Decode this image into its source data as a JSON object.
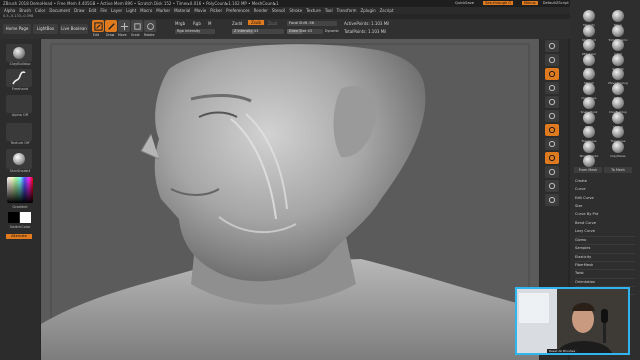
{
  "titlebar": {
    "text": "ZBrush 2018  DemoHead  • Free Mem 4.405GB • Active Mem 896 • Scratch Disk 152 • Timer▸0.016 • PolyCount▸1.102 MP • MeshCount▸1",
    "quicksave": "QuickSave",
    "seethrough": "See-through 0",
    "menus": "Menus",
    "script": "DefaultZScript"
  },
  "menus": [
    "Alpha",
    "Brush",
    "Color",
    "Document",
    "Draw",
    "Edit",
    "File",
    "Layer",
    "Light",
    "Macro",
    "Marker",
    "Material",
    "Movie",
    "Picker",
    "Preferences",
    "Render",
    "Stencil",
    "Stroke",
    "Texture",
    "Tool",
    "Transform",
    "Zplugin",
    "Zscript"
  ],
  "coords": "0.5,-0.133,-0.398",
  "shelf": {
    "home_page": "Home Page",
    "lightbox": "LightBox",
    "live_boolean": "Live Boolean",
    "edit": "Edit",
    "draw": "Draw",
    "move": "Move",
    "scale": "Scale",
    "rotate": "Rotate",
    "mrgb": "Mrgb",
    "rgb": "Rgb",
    "m": "M",
    "zadd": "Zadd",
    "zsub": "Zsub",
    "zcut": "Zcut",
    "rgb_intensity": "Rgb Intensity",
    "z_intensity": "Z Intensity 43",
    "focal_shift": "Focal Shift -56",
    "draw_size": "Draw Size 43",
    "dynamic": "Dynamic",
    "active_points": "ActivePoints: 1.103 Mil",
    "total_points": "TotalPoints: 1.103 Mil",
    "z_intensity_value": 43,
    "draw_size_value": 43
  },
  "leftpanel": {
    "brush": "ClayBuildup",
    "stroke": "Freehand",
    "alpha": "Alpha Off",
    "texture": "Texture Off",
    "material": "SkinShade4",
    "gradient": "Gradient",
    "switch_color": "SwitchColor",
    "alternate": "Alternate"
  },
  "rightcol": [
    "Frame",
    "Move",
    "Scale",
    "Rotate",
    "Floor",
    "Local",
    "LSym",
    "Xyz",
    "Persp",
    "PolyF",
    "Transp",
    "Solo"
  ],
  "brushes": [
    [
      "Magnify",
      "Move"
    ],
    [
      "Standard",
      "TrimDynamic"
    ],
    [
      "ZModeler",
      "Inflat"
    ],
    [
      "Pinch",
      "Smooth"
    ],
    [
      "hPolish",
      "MoveTopolog"
    ],
    [
      "ClayTubes",
      "Polish"
    ],
    [
      "SnakeHook",
      "ClayBuildup"
    ],
    [
      "Pinch",
      "hPolish"
    ],
    [
      "Transpose",
      "Transpose"
    ],
    [
      "Move Elastic",
      "ClayTubes"
    ],
    [
      "DamStandard",
      ""
    ]
  ],
  "brush_buttons": {
    "from_mesh": "From Mesh",
    "to_mesh": "To Mesh"
  },
  "tool_menu": [
    "Create",
    "Curve",
    "Edit Curve",
    "Size",
    "Curve By Pnt",
    "Bend Curve",
    "Lazy Curve",
    "Gizmo",
    "Samples",
    "Elasticity",
    "FiberMesh",
    "Twist",
    "Orientation",
    "Surface",
    "Modifiers"
  ],
  "webcam_caption": "Reset All Brushes"
}
